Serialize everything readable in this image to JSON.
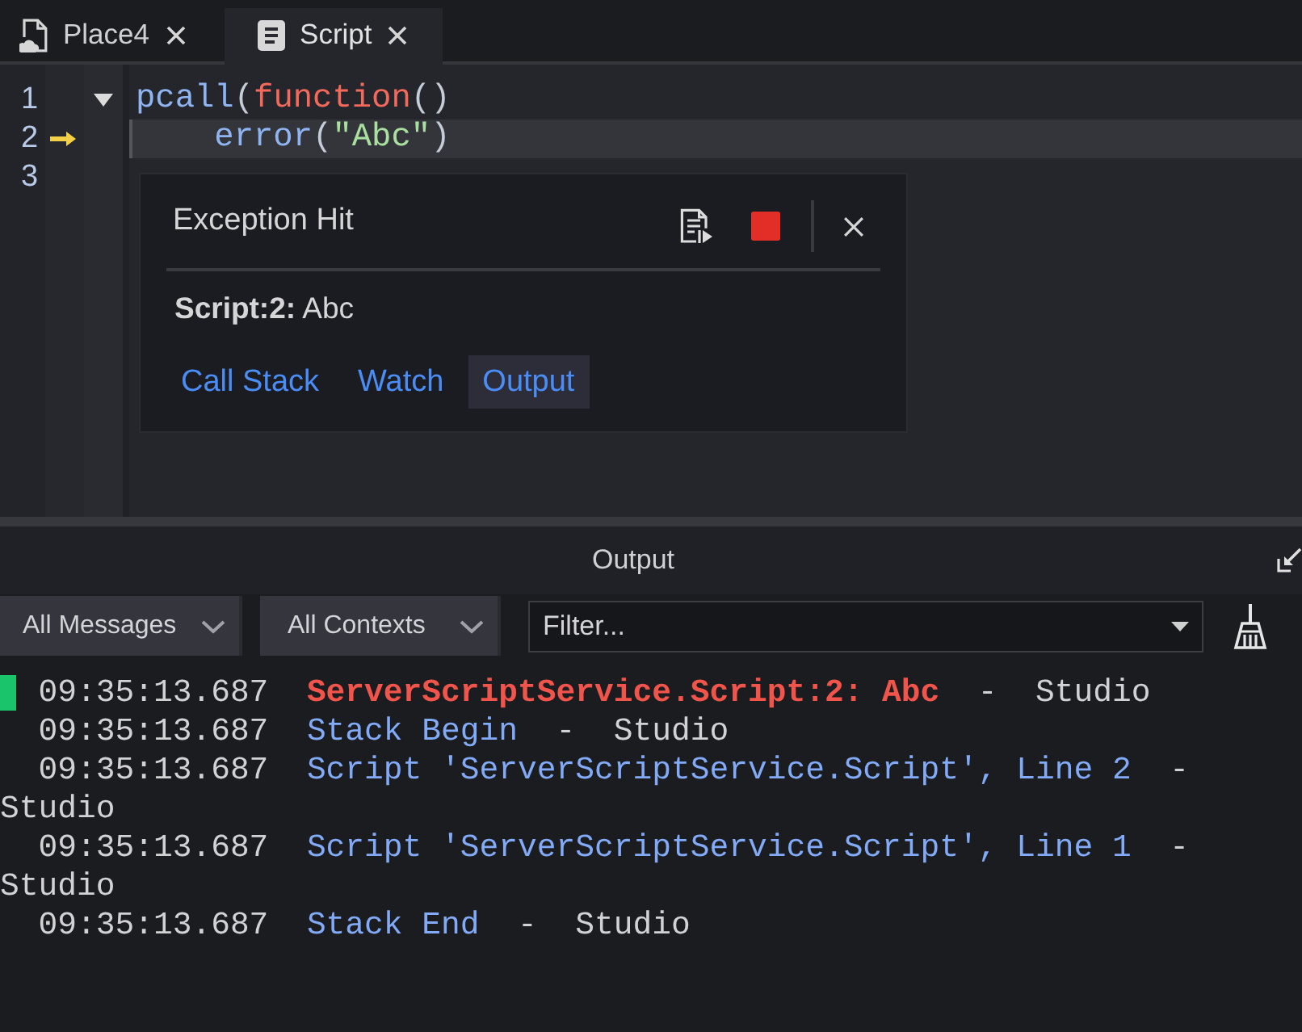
{
  "tabs": [
    {
      "kind": "place",
      "label": "Place4",
      "selected": false
    },
    {
      "kind": "script",
      "label": "Script",
      "selected": true
    }
  ],
  "editor": {
    "lines": [
      {
        "number": "1",
        "current": false,
        "expanded": true,
        "tokens": [
          {
            "kind": "builtin",
            "text": "pcall"
          },
          {
            "kind": "punct",
            "text": "("
          },
          {
            "kind": "keyword",
            "text": "function"
          },
          {
            "kind": "punct",
            "text": "()"
          }
        ],
        "children": [
          {
            "number": "2",
            "current": true,
            "tokens": [
              {
                "kind": "builtin",
                "text": "error"
              },
              {
                "kind": "punct",
                "text": "("
              },
              {
                "kind": "string",
                "text": "\"Abc\""
              },
              {
                "kind": "punct",
                "text": ")"
              }
            ]
          }
        ]
      },
      {
        "number": "3",
        "current": false
      }
    ]
  },
  "exception_popup": {
    "title": "Exception Hit",
    "message": "**Script:2:** Abc",
    "tabs": [
      {
        "label": "Call Stack",
        "selected": false
      },
      {
        "label": "Watch",
        "selected": false
      },
      {
        "label": "Output",
        "selected": true
      }
    ]
  },
  "output": {
    "title": "Output",
    "filters": [
      {
        "label": "All Messages"
      },
      {
        "label": "All Contexts"
      }
    ],
    "search": {
      "placeholder": "Filter..."
    },
    "entries": [
      {
        "time": "09:35:13.687",
        "kind": "error",
        "message": "ServerScriptService.Script:2: Abc",
        "separator": "-",
        "source": "Studio",
        "highlighted": true
      },
      {
        "time": "09:35:13.687",
        "kind": "info",
        "message": "Stack Begin",
        "separator": "-",
        "source": "Studio",
        "highlighted": false
      },
      {
        "time": "09:35:13.687",
        "kind": "info",
        "message": "Script 'ServerScriptService.Script', Line 2",
        "separator": "-",
        "source": "Studio",
        "highlighted": false
      },
      {
        "time": "09:35:13.687",
        "kind": "info",
        "message": "Script 'ServerScriptService.Script', Line 1",
        "separator": "-",
        "source": "Studio",
        "highlighted": false
      },
      {
        "time": "09:35:13.687",
        "kind": "info",
        "message": "Stack End",
        "separator": "-",
        "source": "Studio",
        "highlighted": false
      }
    ]
  }
}
